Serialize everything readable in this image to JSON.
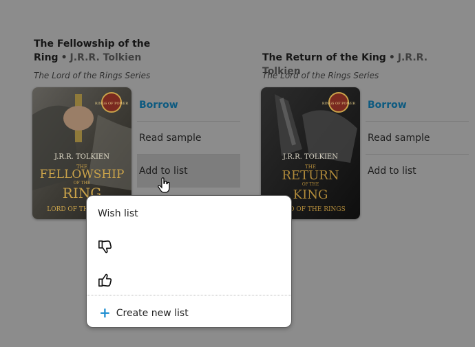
{
  "books": [
    {
      "title": "The Fellowship of the Ring",
      "author": "J.R.R. Tolkien",
      "series": "The Lord of the Rings Series",
      "actions": {
        "borrow": "Borrow",
        "sample": "Read sample",
        "list": "Add to list"
      },
      "cover": {
        "author_line": "J.R.R. TOLKIEN",
        "the": "THE",
        "title_line1": "FELLOWSHIP",
        "of_the": "OF THE",
        "title_line2": "RING",
        "series_logo": "LORD OF THE RINGS",
        "badge": "RINGS OF POWER"
      }
    },
    {
      "title": "The Return of the King",
      "author": "J.R.R. Tolkien",
      "series": "The Lord of the Rings Series",
      "actions": {
        "borrow": "Borrow",
        "sample": "Read sample",
        "list": "Add to list"
      },
      "cover": {
        "author_line": "J.R.R. TOLKIEN",
        "the": "THE",
        "title_line1": "RETURN",
        "of_the": "OF THE",
        "title_line2": "KING",
        "series_logo": "LORD OF THE RINGS",
        "badge": "RINGS OF POWER"
      }
    }
  ],
  "popup": {
    "wish_list": "Wish list",
    "dislike_icon": "thumbs-down-icon",
    "like_icon": "thumbs-up-icon",
    "create_list": "Create new list",
    "plus_symbol": "+"
  },
  "colors": {
    "borrow": "#0d5a80",
    "plus": "#1f8ed1",
    "overlay_bg": "#8c8c8c"
  },
  "separator": "•"
}
